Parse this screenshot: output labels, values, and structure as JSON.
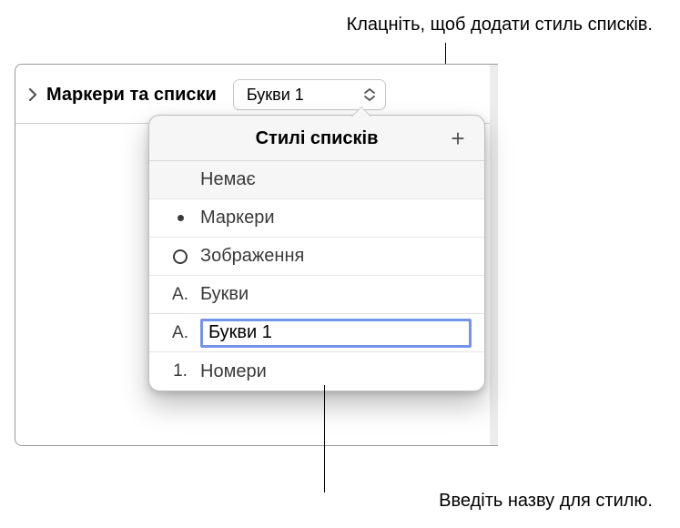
{
  "callouts": {
    "top": "Клацніть, щоб додати стиль списків.",
    "bottom": "Введіть назву для стилю."
  },
  "header": {
    "section_label": "Маркери та списки",
    "dropdown_value": "Букви 1"
  },
  "popover": {
    "title": "Стилі списків",
    "add_icon": "+",
    "items": [
      {
        "marker_type": "none",
        "marker": "",
        "label": "Немає",
        "editing": false
      },
      {
        "marker_type": "bullet",
        "marker": "•",
        "label": "Маркери",
        "editing": false
      },
      {
        "marker_type": "image",
        "marker": "○",
        "label": "Зображення",
        "editing": false
      },
      {
        "marker_type": "letter",
        "marker": "A.",
        "label": "Букви",
        "editing": false
      },
      {
        "marker_type": "letter",
        "marker": "A.",
        "label": "Букви 1",
        "editing": true
      },
      {
        "marker_type": "number",
        "marker": "1.",
        "label": "Номери",
        "editing": false
      }
    ]
  }
}
